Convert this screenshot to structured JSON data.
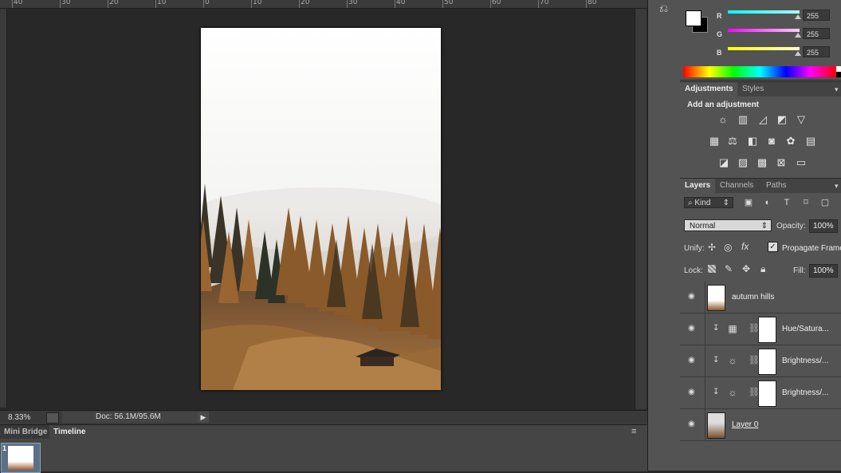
{
  "ruler": {
    "ticks": [
      "40",
      "30",
      "20",
      "10",
      "0",
      "10",
      "20",
      "30",
      "40",
      "50",
      "60",
      "70",
      "80"
    ]
  },
  "status_bar": {
    "zoom": "8.33%",
    "doc_info": "Doc: 56.1M/95.6M",
    "arrow": "▶"
  },
  "bottom_panel": {
    "tabs": [
      "Mini Bridge",
      "Timeline"
    ],
    "active_tab": "Timeline",
    "frame_number": "1",
    "menu": "≡"
  },
  "color_panel": {
    "channels": [
      {
        "label": "R",
        "value": "255",
        "color": "#e03030"
      },
      {
        "label": "G",
        "value": "255",
        "color": "#30c030"
      },
      {
        "label": "B",
        "value": "255",
        "color": "#3060e0"
      }
    ]
  },
  "adjustments_panel": {
    "tabs": [
      "Adjustments",
      "Styles"
    ],
    "heading": "Add an adjustment",
    "icons": [
      "brightness-contrast",
      "levels",
      "curves",
      "exposure",
      "vibrance",
      "hue-saturation",
      "color-balance",
      "black-white",
      "photo-filter",
      "channel-mixer",
      "color-lookup",
      "invert",
      "posterize",
      "threshold",
      "selective-color",
      "gradient-map"
    ]
  },
  "layers_panel": {
    "tabs": [
      "Layers",
      "Channels",
      "Paths"
    ],
    "filter": "Kind",
    "blend_mode": "Normal",
    "opacity_label": "Opacity:",
    "opacity": "100%",
    "unify_label": "Unify:",
    "propagate_label": "Propagate Frame",
    "lock_label": "Lock:",
    "fill_label": "Fill:",
    "fill": "100%",
    "layers": [
      {
        "name": "autumn hills",
        "selected": true
      },
      {
        "name": "Hue/Satura..."
      },
      {
        "name": "Brightness/..."
      },
      {
        "name": "Brightness/..."
      },
      {
        "name": "Layer 0"
      }
    ]
  }
}
